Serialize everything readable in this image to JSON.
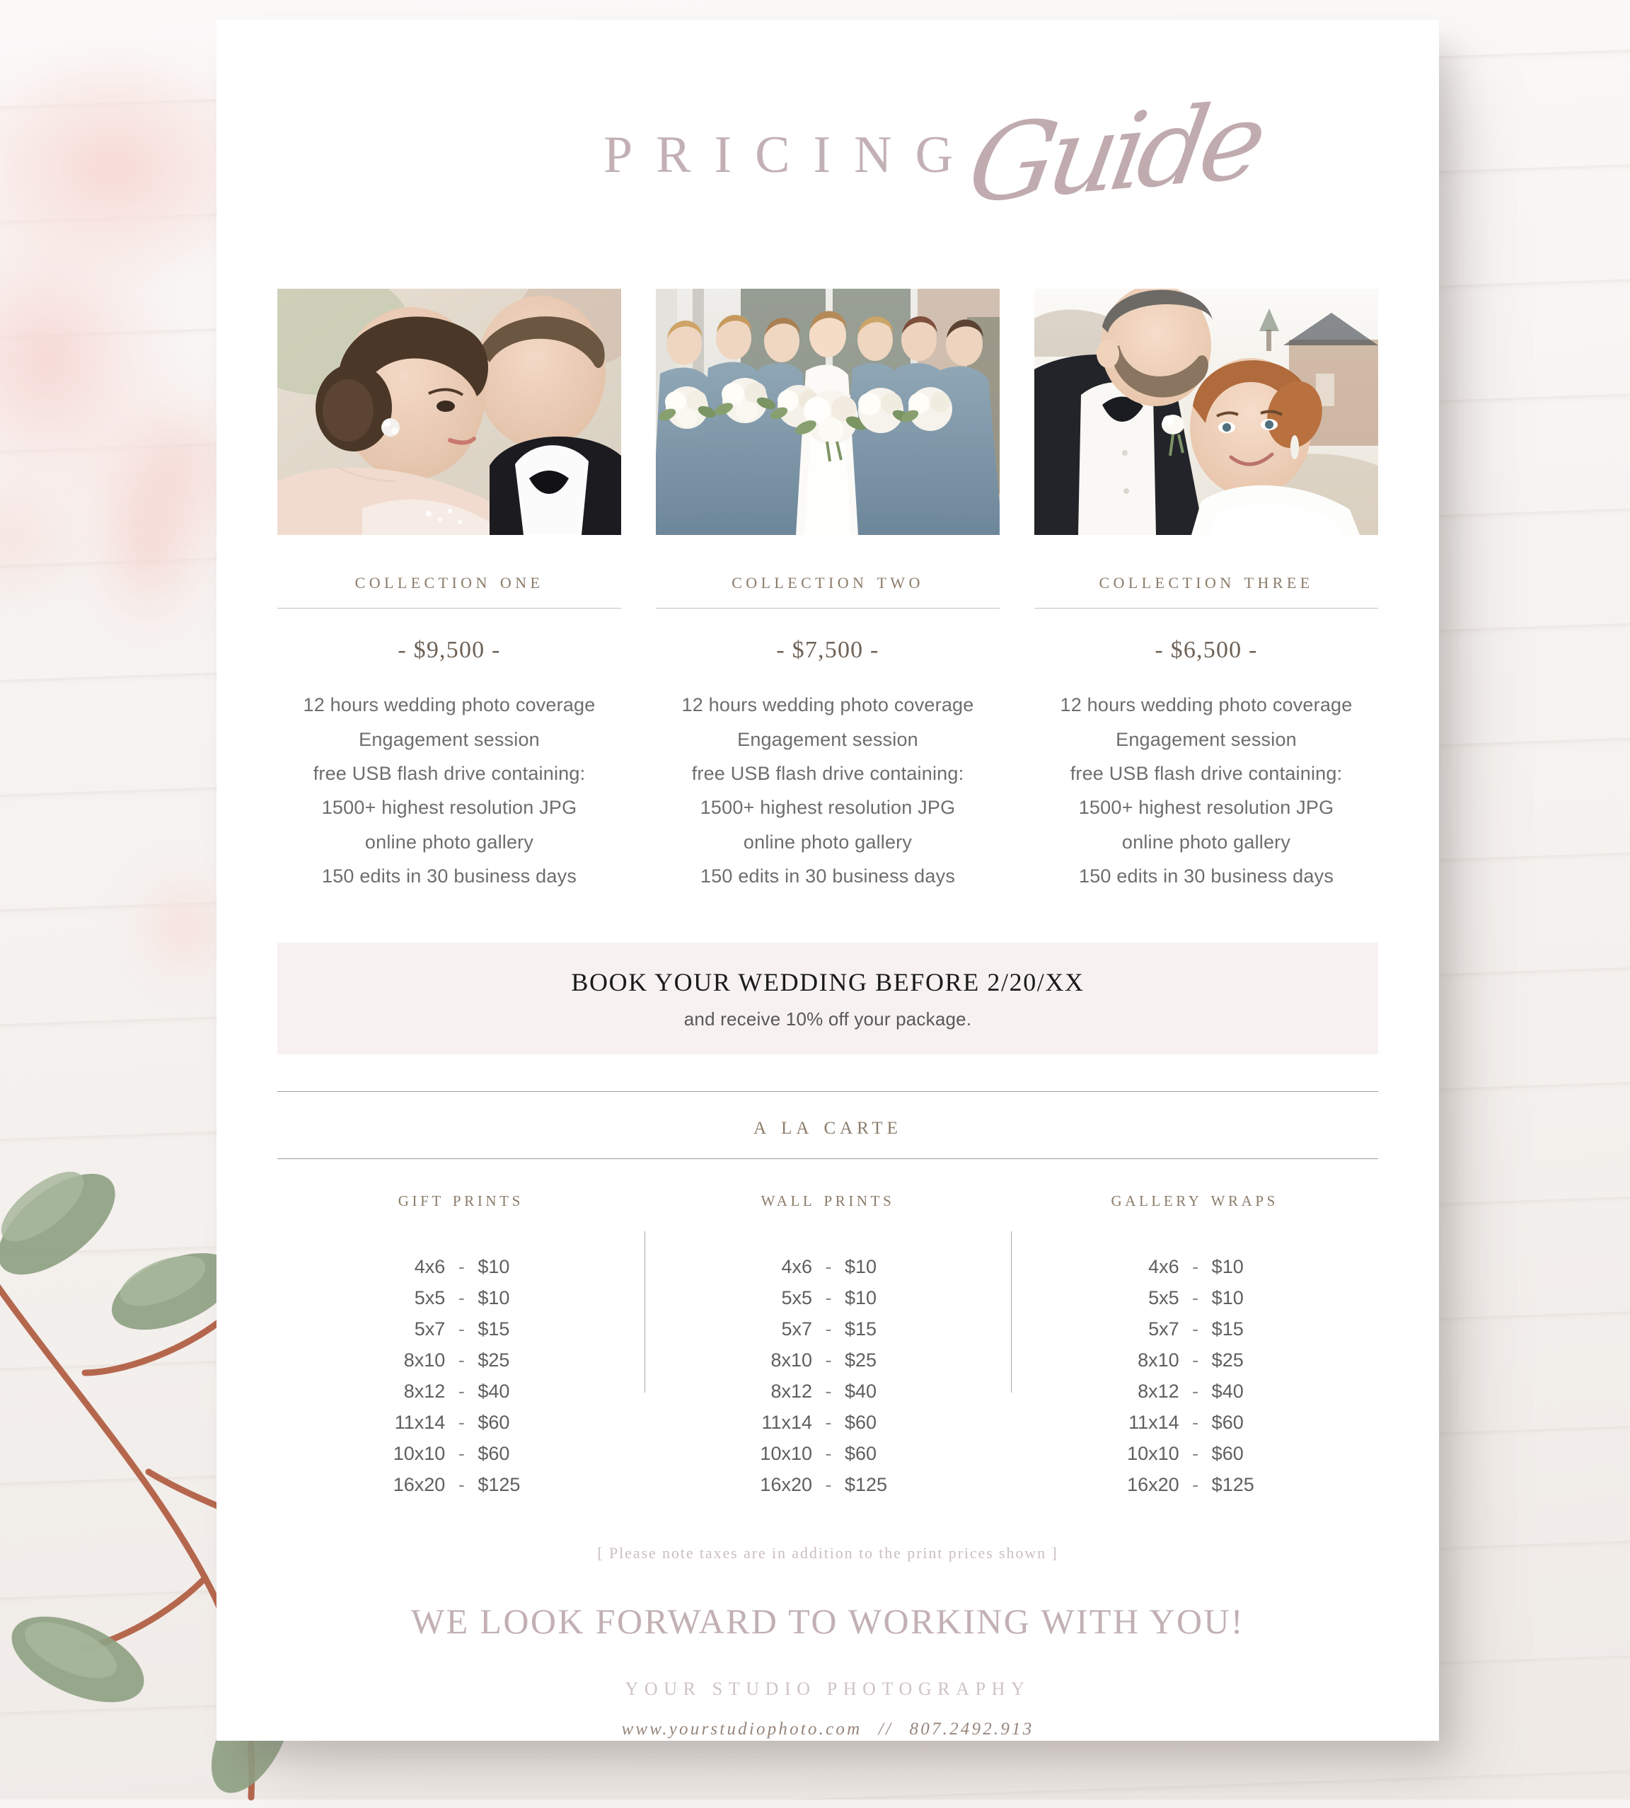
{
  "title": {
    "main": "PRICING",
    "script": "Guide"
  },
  "photos": [
    {
      "alt": "bride and groom embracing close-up"
    },
    {
      "alt": "bride with six bridesmaids in dusty blue dresses holding white bouquets"
    },
    {
      "alt": "groom kissing bride on the forehead outdoors"
    }
  ],
  "collections": [
    {
      "name": "Collection One",
      "price": "- $9,500 -",
      "features": [
        "12 hours wedding photo coverage",
        "Engagement session",
        "free USB flash drive containing:",
        "1500+ highest resolution JPG",
        "online photo gallery",
        "150 edits in 30 business days"
      ]
    },
    {
      "name": "Collection Two",
      "price": "- $7,500 -",
      "features": [
        "12 hours wedding photo coverage",
        "Engagement session",
        "free USB flash drive containing:",
        "1500+ highest resolution JPG",
        "online photo gallery",
        "150 edits in 30 business days"
      ]
    },
    {
      "name": "Collection Three",
      "price": "- $6,500 -",
      "features": [
        "12 hours wedding photo coverage",
        "Engagement session",
        "free USB flash drive containing:",
        "1500+ highest resolution JPG",
        "online photo gallery",
        "150 edits in 30 business days"
      ]
    }
  ],
  "banner": {
    "headline": "BOOK YOUR WEDDING BEFORE 2/20/XX",
    "subline": "and receive 10% off your package."
  },
  "a_la_carte": {
    "section_title": "A La Carte",
    "columns": [
      {
        "title": "Gift Prints",
        "rows": [
          {
            "size": "4x6",
            "dash": "-",
            "price": "$10"
          },
          {
            "size": "5x5",
            "dash": "-",
            "price": "$10"
          },
          {
            "size": "5x7",
            "dash": "-",
            "price": "$15"
          },
          {
            "size": "8x10",
            "dash": "-",
            "price": "$25"
          },
          {
            "size": "8x12",
            "dash": "-",
            "price": "$40"
          },
          {
            "size": "11x14",
            "dash": "-",
            "price": "$60"
          },
          {
            "size": "10x10",
            "dash": "-",
            "price": "$60"
          },
          {
            "size": "16x20",
            "dash": "-",
            "price": "$125"
          }
        ]
      },
      {
        "title": "Wall Prints",
        "rows": [
          {
            "size": "4x6",
            "dash": "-",
            "price": "$10"
          },
          {
            "size": "5x5",
            "dash": "-",
            "price": "$10"
          },
          {
            "size": "5x7",
            "dash": "-",
            "price": "$15"
          },
          {
            "size": "8x10",
            "dash": "-",
            "price": "$25"
          },
          {
            "size": "8x12",
            "dash": "-",
            "price": "$40"
          },
          {
            "size": "11x14",
            "dash": "-",
            "price": "$60"
          },
          {
            "size": "10x10",
            "dash": "-",
            "price": "$60"
          },
          {
            "size": "16x20",
            "dash": "-",
            "price": "$125"
          }
        ]
      },
      {
        "title": "Gallery Wraps",
        "rows": [
          {
            "size": "4x6",
            "dash": "-",
            "price": "$10"
          },
          {
            "size": "5x5",
            "dash": "-",
            "price": "$10"
          },
          {
            "size": "5x7",
            "dash": "-",
            "price": "$15"
          },
          {
            "size": "8x10",
            "dash": "-",
            "price": "$25"
          },
          {
            "size": "8x12",
            "dash": "-",
            "price": "$40"
          },
          {
            "size": "11x14",
            "dash": "-",
            "price": "$60"
          },
          {
            "size": "10x10",
            "dash": "-",
            "price": "$60"
          },
          {
            "size": "16x20",
            "dash": "-",
            "price": "$125"
          }
        ]
      }
    ],
    "tax_note": "[ Please note taxes are in addition to the print prices shown ]"
  },
  "footer": {
    "closing": "WE LOOK FORWARD TO WORKING WITH YOU!",
    "studio": "YOUR STUDIO PHOTOGRAPHY",
    "website": "www.yourstudiophoto.com",
    "separator": "//",
    "phone": "807.2492.913"
  },
  "colors": {
    "title_mauve": "#c3b0b4",
    "heading_gold": "#8b7b69",
    "body_gray": "#6d6d6d",
    "banner_bg": "#f7f1f1",
    "sheet_bg": "#ffffff",
    "footer_mauve": "#c2b0b3"
  }
}
